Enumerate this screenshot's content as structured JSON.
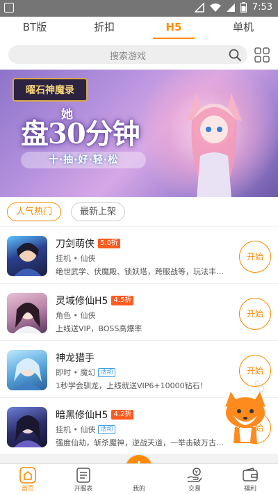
{
  "status_bar": {
    "time": "7:53"
  },
  "tabs": [
    {
      "label": "BT版"
    },
    {
      "label": "折扣"
    },
    {
      "label": "H5"
    },
    {
      "label": "单机"
    }
  ],
  "search": {
    "placeholder": "搜索游戏"
  },
  "banner": {
    "logo_text": "曜石神魔录",
    "small_word": "她",
    "headline": "盘30分钟",
    "tagline": "十·抽·好·轻·松"
  },
  "filters": [
    {
      "label": "人气热门",
      "active": true
    },
    {
      "label": "最新上架",
      "active": false
    }
  ],
  "games": [
    {
      "name": "刀剑萌侠",
      "discount": "5.0折",
      "meta": "挂机 • 仙侠",
      "badge": "",
      "desc": "绝世武学、伏魔殿、锁妖塔，跨服战等，玩法丰富拼",
      "button": "开始"
    },
    {
      "name": "灵域修仙H5",
      "discount": "4.5折",
      "meta": "角色 • 仙侠",
      "badge": "",
      "desc": "上线送VIP，BOSS高爆率",
      "button": "开始"
    },
    {
      "name": "神龙猎手",
      "discount": "",
      "meta": "即时 • 魔幻",
      "badge": "活动",
      "desc": "1秒学会驯龙，上线就送VIP6+10000钻石！",
      "button": "开始"
    },
    {
      "name": "暗黑修仙H5",
      "discount": "4.2折",
      "meta": "挂机 • 仙侠",
      "badge": "活动",
      "desc": "强度仙劫，斩杀魔神，逆战天道，一举击破万古梯锁",
      "button": "开始"
    }
  ],
  "bottom_nav": [
    {
      "label": "首页",
      "icon": "home-icon",
      "active": true
    },
    {
      "label": "开服表",
      "icon": "list-icon",
      "active": false
    },
    {
      "label": "我的",
      "icon": "plus-icon",
      "active": false
    },
    {
      "label": "交易",
      "icon": "trade-icon",
      "active": false
    },
    {
      "label": "福利",
      "icon": "wallet-icon",
      "active": false
    }
  ],
  "colors": {
    "accent": "#ff8a00",
    "discount": "#ff5a1f",
    "activity": "#3a9de8"
  }
}
